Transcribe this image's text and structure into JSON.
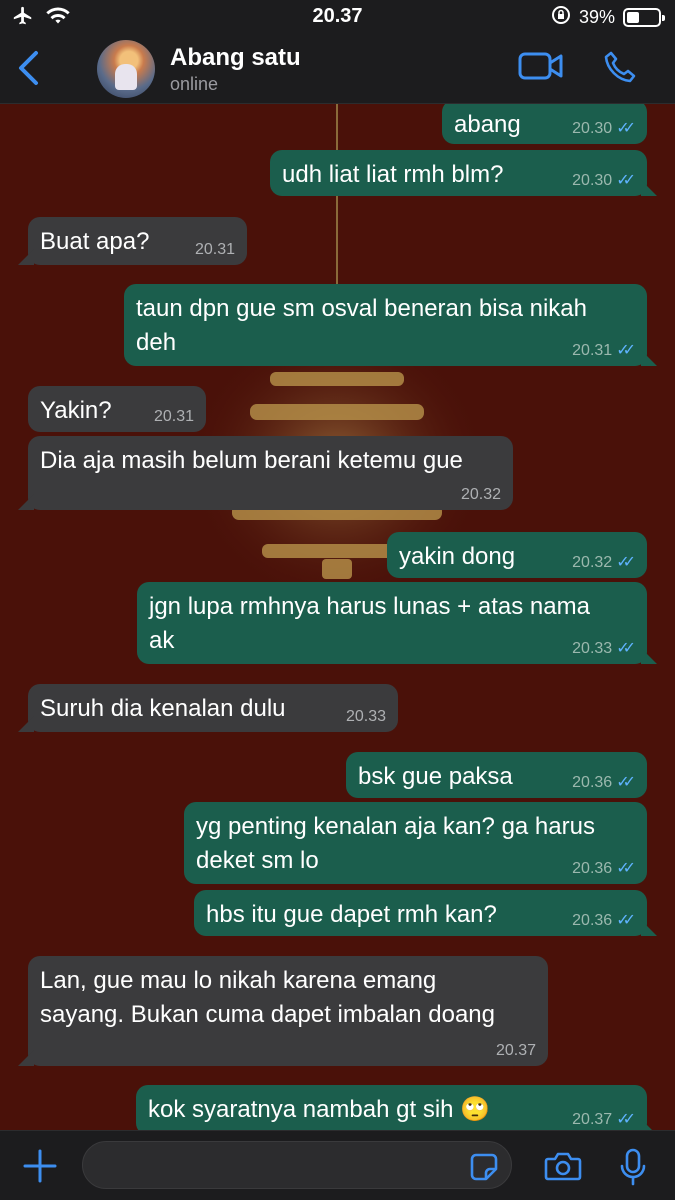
{
  "status_bar": {
    "time": "20.37",
    "battery": "39%"
  },
  "header": {
    "contact_name": "Abang satu",
    "status": "online"
  },
  "messages": [
    {
      "dir": "out",
      "text": "abang",
      "time": "20.30"
    },
    {
      "dir": "out",
      "text": "udh liat liat rmh blm?",
      "time": "20.30"
    },
    {
      "dir": "in",
      "text": "Buat apa?",
      "time": "20.31"
    },
    {
      "dir": "out",
      "text": "taun dpn gue sm osval beneran bisa nikah\ndeh",
      "time": "20.31"
    },
    {
      "dir": "in",
      "text": "Yakin?",
      "time": "20.31"
    },
    {
      "dir": "in",
      "text": "Dia aja masih belum berani ketemu gue",
      "time": "20.32"
    },
    {
      "dir": "out",
      "text": "yakin dong",
      "time": "20.32"
    },
    {
      "dir": "out",
      "text": "jgn lupa rmhnya harus lunas + atas nama\nak",
      "time": "20.33"
    },
    {
      "dir": "in",
      "text": "Suruh dia kenalan dulu",
      "time": "20.33"
    },
    {
      "dir": "out",
      "text": "bsk gue paksa",
      "time": "20.36"
    },
    {
      "dir": "out",
      "text": "yg penting kenalan aja kan? ga harus\ndeket sm lo",
      "time": "20.36"
    },
    {
      "dir": "out",
      "text": "hbs itu gue dapet rmh kan?",
      "time": "20.36"
    },
    {
      "dir": "in",
      "text": "Lan, gue mau lo nikah karena emang\nsayang. Bukan cuma dapet imbalan doang",
      "time": "20.37"
    },
    {
      "dir": "out",
      "text": "kok syaratnya nambah gt sih 🙄",
      "time": "20.37"
    }
  ],
  "colors": {
    "accent": "#3d8ef0",
    "chat_bg": "#4a1109",
    "bubble_in": "#3b3b3d",
    "bubble_out": "#1b5e4d",
    "read_ticks": "#5fb3ff"
  },
  "icons": [
    "airplane-icon",
    "wifi-icon",
    "rotation-lock-icon",
    "battery-icon",
    "back-chevron-icon",
    "video-call-icon",
    "phone-icon",
    "plus-icon",
    "sticker-icon",
    "camera-icon",
    "microphone-icon"
  ]
}
